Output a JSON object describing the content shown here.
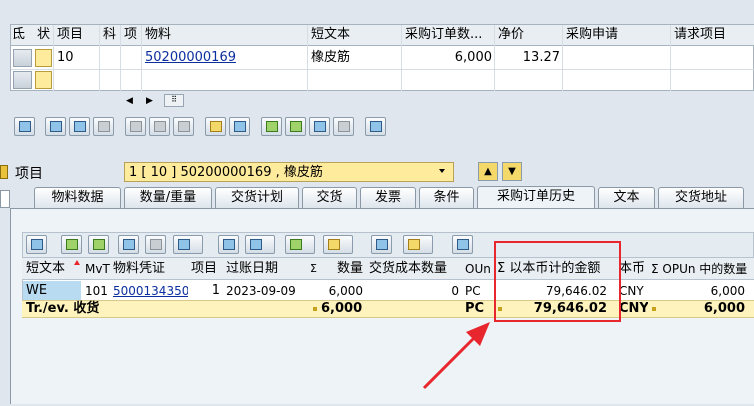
{
  "colors": {
    "accent_red": "#e8262d",
    "highlight_yellow": "#ffeb9c",
    "link_blue": "#0b2f9e"
  },
  "item_table": {
    "headers": [
      "氐",
      "状",
      "项目",
      "科",
      "项",
      "物料",
      "短文本",
      "采购订单数...",
      "净价",
      "采购申请",
      "请求项目"
    ],
    "row": {
      "item": "10",
      "material": "50200000169",
      "short_text": "橡皮筋",
      "quantity": "6,000",
      "net_price": "13.27"
    }
  },
  "item_selector": {
    "label": "项目",
    "value": "1 [ 10 ] 50200000169 , 橡皮筋"
  },
  "tabs": [
    "物料数据",
    "数量/重量",
    "交货计划",
    "交货",
    "发票",
    "条件",
    "采购订单历史",
    "文本",
    "交货地址"
  ],
  "active_tab_index": 6,
  "history_table": {
    "headers": [
      "短文本",
      "MvT",
      "物料凭证",
      "项目",
      "过账日期",
      "Σ",
      "数量",
      "交货成本数量",
      "OUn",
      "Σ 以本币计的金额",
      "本币",
      "Σ OPUn 中的数量"
    ],
    "row": {
      "short_text": "WE",
      "mvt": "101",
      "doc": "5000134350",
      "item": "1",
      "date": "2023-09-09",
      "qty": "6,000",
      "cost_qty": "0",
      "oun": "PC",
      "amount": "79,646.02",
      "currency": "CNY",
      "opun_qty": "6,000"
    },
    "total": {
      "label": "Tr./ev. 收货",
      "qty": "6,000",
      "oun": "PC",
      "amount": "79,646.02",
      "currency": "CNY",
      "opun_qty": "6,000"
    }
  }
}
